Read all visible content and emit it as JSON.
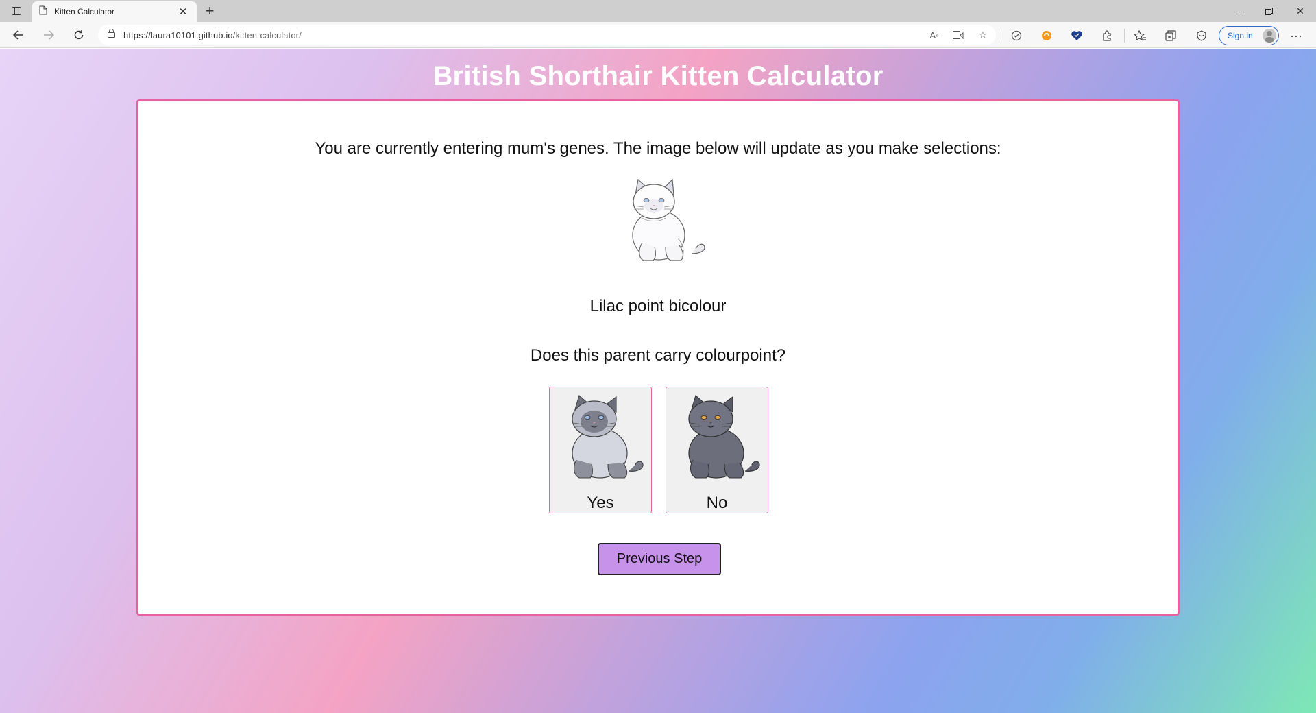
{
  "browser": {
    "tab_title": "Kitten Calculator",
    "url_host": "https://laura10101.github.io",
    "url_path": "/kitten-calculator/",
    "sign_in_label": "Sign in"
  },
  "page": {
    "title": "British Shorthair Kitten Calculator",
    "instruction": "You are currently entering mum's genes. The image below will update as you make selections:",
    "current_breed": "Lilac point bicolour",
    "question": "Does this parent carry colourpoint?",
    "options": [
      {
        "label": "Yes",
        "icon": "colourpoint-cat"
      },
      {
        "label": "No",
        "icon": "blue-cat"
      }
    ],
    "previous_button": "Previous Step"
  },
  "colors": {
    "card_border": "#e8639e",
    "button_bg": "#c792ea"
  }
}
